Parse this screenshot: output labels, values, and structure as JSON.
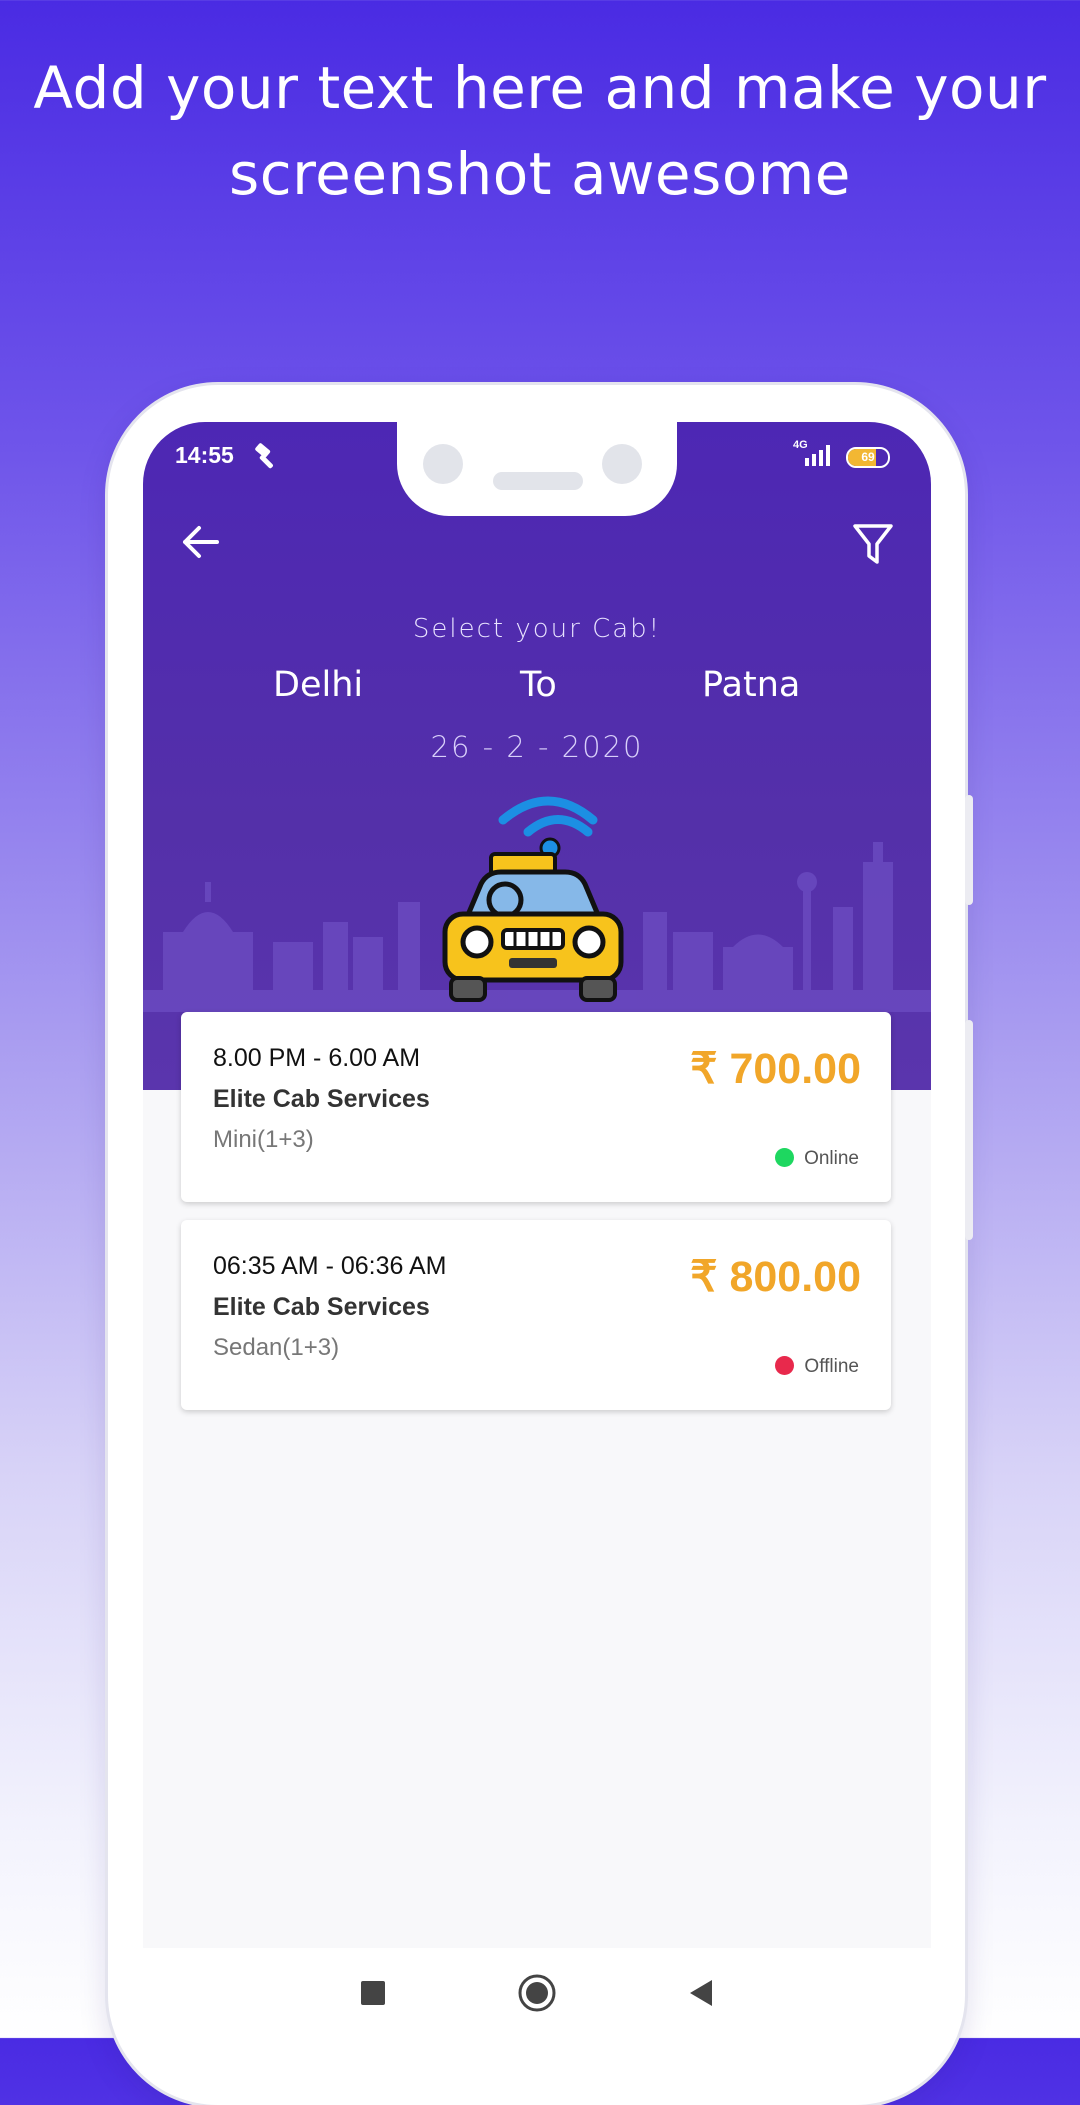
{
  "promo": {
    "line1": "Add your text here and make your",
    "line2": "screenshot awesome"
  },
  "status_bar": {
    "time": "14:55",
    "network_top": "4G",
    "battery_level": "69",
    "battery_fraction": 0.69,
    "battery_color": "#f2b733"
  },
  "header": {
    "back_icon": "arrow-left-icon",
    "filter_icon": "filter-icon",
    "title": "Select your Cab!",
    "from": "Delhi",
    "to_label": "To",
    "to": "Patna",
    "date": "26 - 2 - 2020"
  },
  "cabs": [
    {
      "time": "8.00 PM - 6.00 AM",
      "company": "Elite Cab Services",
      "type": "Mini(1+3)",
      "price": "₹ 700.00",
      "status": "Online",
      "status_color": "#1ed760"
    },
    {
      "time": "06:35 AM - 06:36 AM",
      "company": "Elite Cab Services",
      "type": "Sedan(1+3)",
      "price": "₹ 800.00",
      "status": "Offline",
      "status_color": "#e8294c"
    }
  ],
  "colors": {
    "accent": "#5430a9",
    "price": "#f1a629"
  },
  "nav": {
    "recent_icon": "square-icon",
    "home_icon": "circle-icon",
    "back_icon": "triangle-back-icon"
  }
}
